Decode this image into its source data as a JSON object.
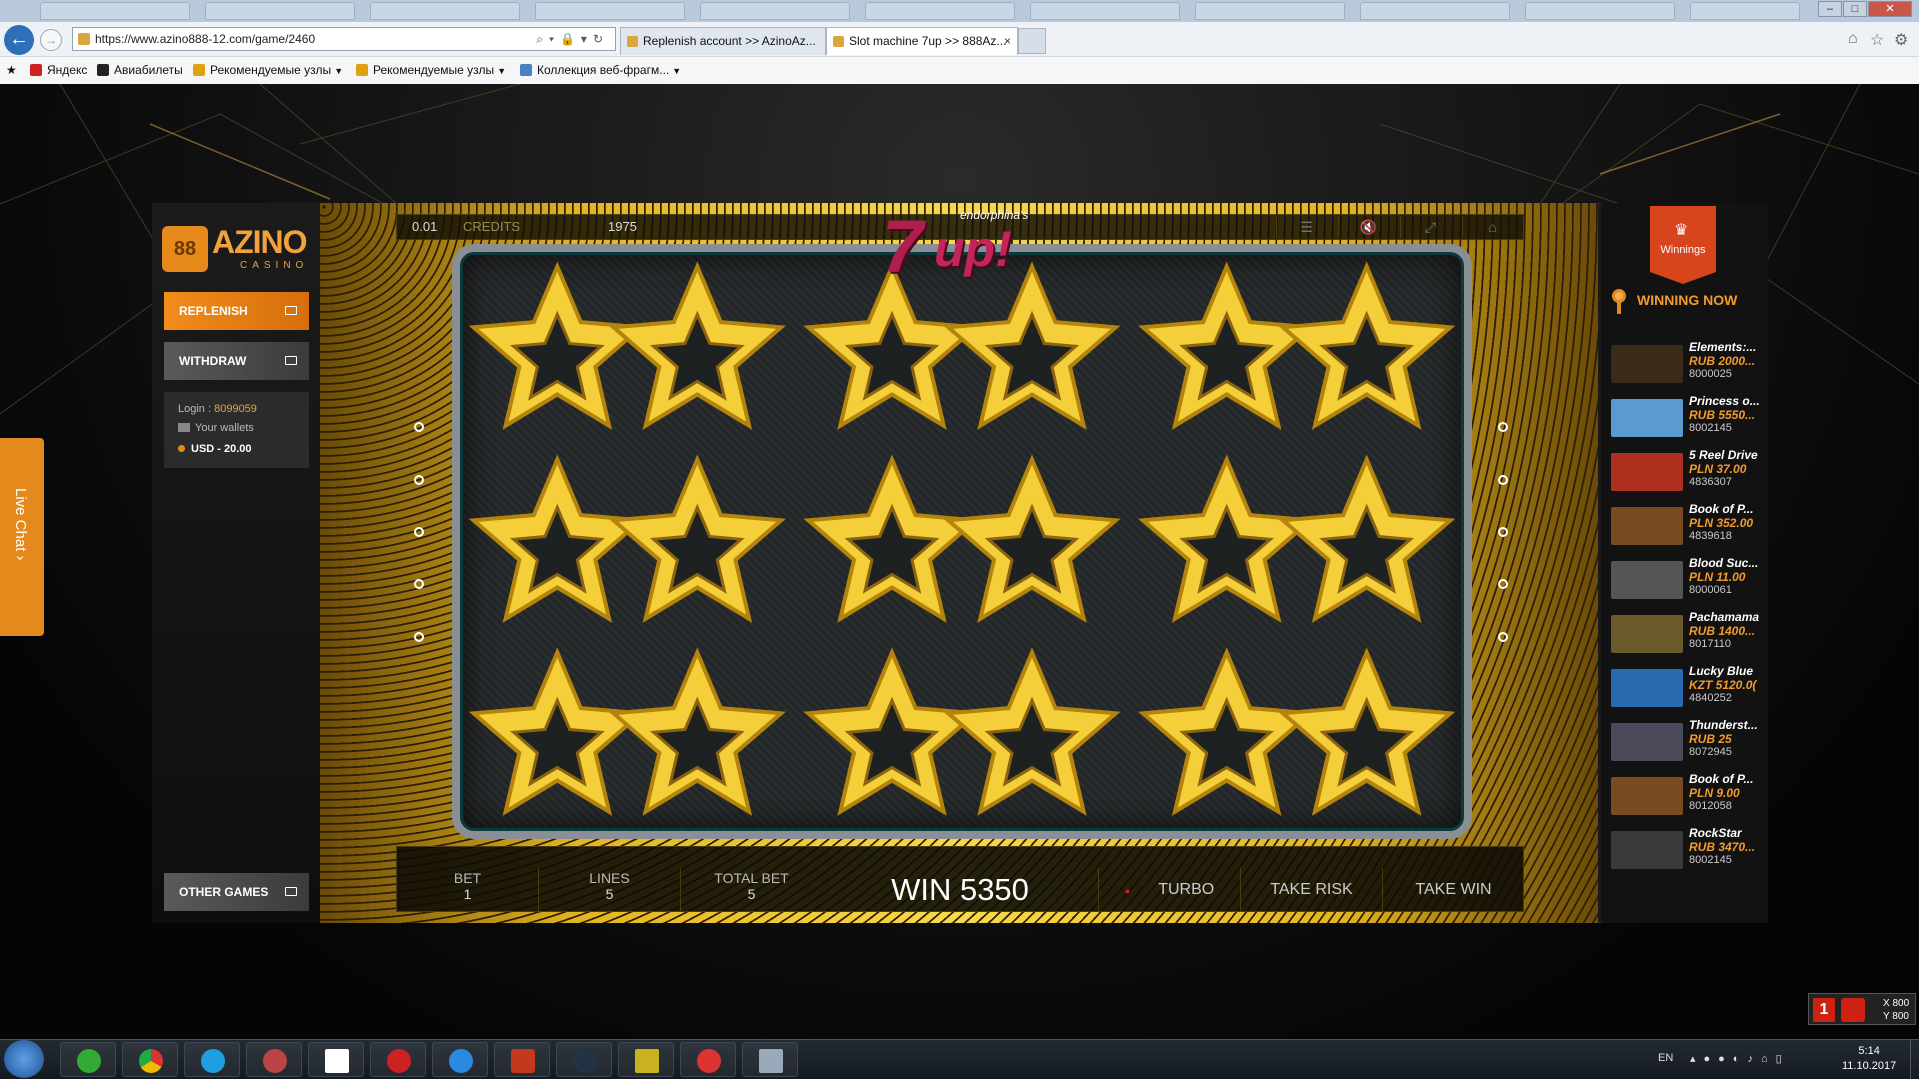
{
  "browser": {
    "url": "https://www.azino888-12.com/game/2460",
    "tabs": [
      {
        "label": "Replenish account >> AzinoAz...",
        "active": false
      },
      {
        "label": "Slot machine 7up >> 888Az...",
        "active": true
      }
    ],
    "tab_close_symbol": "×",
    "favorites": [
      {
        "label": "Яндекс",
        "icon_color": "#d02020",
        "dropdown": false
      },
      {
        "label": "Авиабилеты",
        "icon_color": "#222222",
        "dropdown": false
      },
      {
        "label": "Рекомендуемые узлы",
        "icon_color": "#e0a010",
        "dropdown": true
      },
      {
        "label": "Рекомендуемые узлы",
        "icon_color": "#e0a010",
        "dropdown": true
      },
      {
        "label": "Коллекция веб-фрагм...",
        "icon_color": "#4a7fc0",
        "dropdown": true
      }
    ]
  },
  "site": {
    "logo": {
      "mark": "88",
      "word": "AZINO",
      "sub": "CASINO"
    },
    "live_chat": "Live Chat ›",
    "replenish": "REPLENISH",
    "withdraw": "WITHDRAW",
    "other_games": "OTHER GAMES",
    "account": {
      "login_label": "Login :",
      "login_value": "8099059",
      "wallets": "Your wallets",
      "balance": "USD - 20.00"
    }
  },
  "game": {
    "title_seven": "7",
    "title_up": "up!",
    "title_brand": "endorphina's",
    "denomination": "0.01",
    "credits_label": "CREDITS",
    "credits": "1975",
    "symbol": "double-star",
    "reel_grid": [
      3,
      3
    ],
    "bet_label": "BET",
    "bet": "1",
    "lines_label": "LINES",
    "lines": "5",
    "total_bet_label": "TOTAL BET",
    "total_bet": "5",
    "win_text": "WIN 5350",
    "turbo": "TURBO",
    "take_risk": "TAKE RISK",
    "take_win": "TAKE WIN",
    "gold": "#f4cf3a",
    "gold_dark": "#b4840c"
  },
  "winnings_panel": {
    "tab_label": "Winnings",
    "heading": "WINNING NOW",
    "items": [
      {
        "name": "Elements:...",
        "amount": "RUB 2000...",
        "id": "8000025",
        "thumb": "#3a2a1a"
      },
      {
        "name": "Princess o...",
        "amount": "RUB 5550...",
        "id": "8002145",
        "thumb": "#5a9ad0"
      },
      {
        "name": "5 Reel Drive",
        "amount": "PLN 37.00",
        "id": "4836307",
        "thumb": "#b03020"
      },
      {
        "name": "Book of P...",
        "amount": "PLN 352.00",
        "id": "4839618",
        "thumb": "#7a4a20"
      },
      {
        "name": "Blood Suc...",
        "amount": "PLN 11.00",
        "id": "8000061",
        "thumb": "#555555"
      },
      {
        "name": "Pachamama",
        "amount": "RUB 1400...",
        "id": "8017110",
        "thumb": "#6a5a2a"
      },
      {
        "name": "Lucky Blue",
        "amount": "KZT 5120.0(",
        "id": "4840252",
        "thumb": "#2a6ab0"
      },
      {
        "name": "Thunderst...",
        "amount": "RUB 25",
        "id": "8072945",
        "thumb": "#4a4a5a"
      },
      {
        "name": "Book of P...",
        "amount": "PLN 9.00",
        "id": "8012058",
        "thumb": "#7a4a20"
      },
      {
        "name": "RockStar",
        "amount": "RUB 3470...",
        "id": "8002145",
        "thumb": "#3a3a3a"
      }
    ]
  },
  "taskbar": {
    "lang": "EN",
    "time": "5:14",
    "date": "11.10.2017",
    "mini_one": "1",
    "mini_x": "X 800",
    "mini_y": "Y 800"
  }
}
